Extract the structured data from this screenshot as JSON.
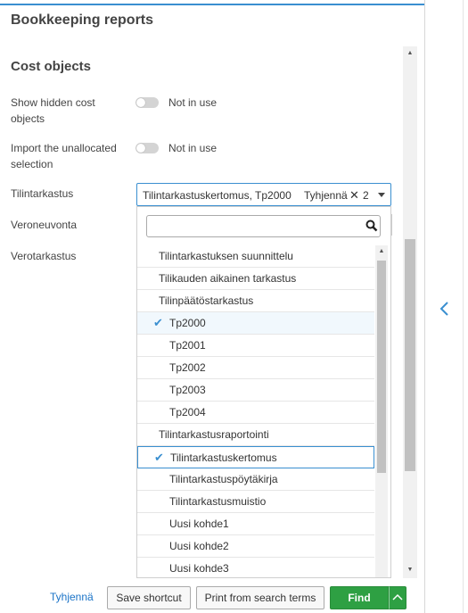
{
  "header": {
    "title": "Bookkeeping reports"
  },
  "section": {
    "title": "Cost objects"
  },
  "fields": {
    "hidden_cost_objects": {
      "label": "Show hidden cost objects",
      "value": "Not in use"
    },
    "import_unallocated": {
      "label": "Import the unallocated selection",
      "value": "Not in use"
    },
    "tilintarkastus": {
      "label": "Tilintarkastus",
      "value": "Tilintarkastuskertomus, Tp2000",
      "clear_label": "Tyhjennä",
      "clear_icon": "✕",
      "count": "2"
    },
    "veroneuvonta": {
      "label": "Veroneuvonta"
    },
    "verotarkastus": {
      "label": "Verotarkastus"
    }
  },
  "dropdown": {
    "search": {
      "value": "",
      "placeholder": ""
    },
    "items": [
      {
        "label": "Tilintarkastuksen suunnittelu",
        "level": "group",
        "checked": false
      },
      {
        "label": "Tilikauden aikainen tarkastus",
        "level": "group",
        "checked": false
      },
      {
        "label": "Tilinpäätöstarkastus",
        "level": "group",
        "checked": false
      },
      {
        "label": "Tp2000",
        "level": "child",
        "checked": true
      },
      {
        "label": "Tp2001",
        "level": "child",
        "checked": false
      },
      {
        "label": "Tp2002",
        "level": "child",
        "checked": false
      },
      {
        "label": "Tp2003",
        "level": "child",
        "checked": false
      },
      {
        "label": "Tp2004",
        "level": "child",
        "checked": false
      },
      {
        "label": "Tilintarkastusraportointi",
        "level": "group",
        "checked": false
      },
      {
        "label": "Tilintarkastuskertomus",
        "level": "child",
        "checked": true,
        "focused": true
      },
      {
        "label": "Tilintarkastuspöytäkirja",
        "level": "child",
        "checked": false
      },
      {
        "label": "Tilintarkastusmuistio",
        "level": "child",
        "checked": false
      },
      {
        "label": "Uusi kohde1",
        "level": "child",
        "checked": false
      },
      {
        "label": "Uusi kohde2",
        "level": "child",
        "checked": false
      },
      {
        "label": "Uusi kohde3",
        "level": "child",
        "checked": false
      }
    ]
  },
  "footer": {
    "clear_link": "Tyhjennä",
    "save_shortcut": "Save shortcut",
    "print_search_terms": "Print from search terms",
    "find": "Find"
  },
  "colors": {
    "accent": "#3a8fd0",
    "find": "#2ea043",
    "link": "#1a73c7"
  },
  "icons": {
    "check": "checkmark-icon",
    "search": "search-icon",
    "collapse": "chevron-left-icon",
    "find_menu": "chevron-up-icon"
  }
}
